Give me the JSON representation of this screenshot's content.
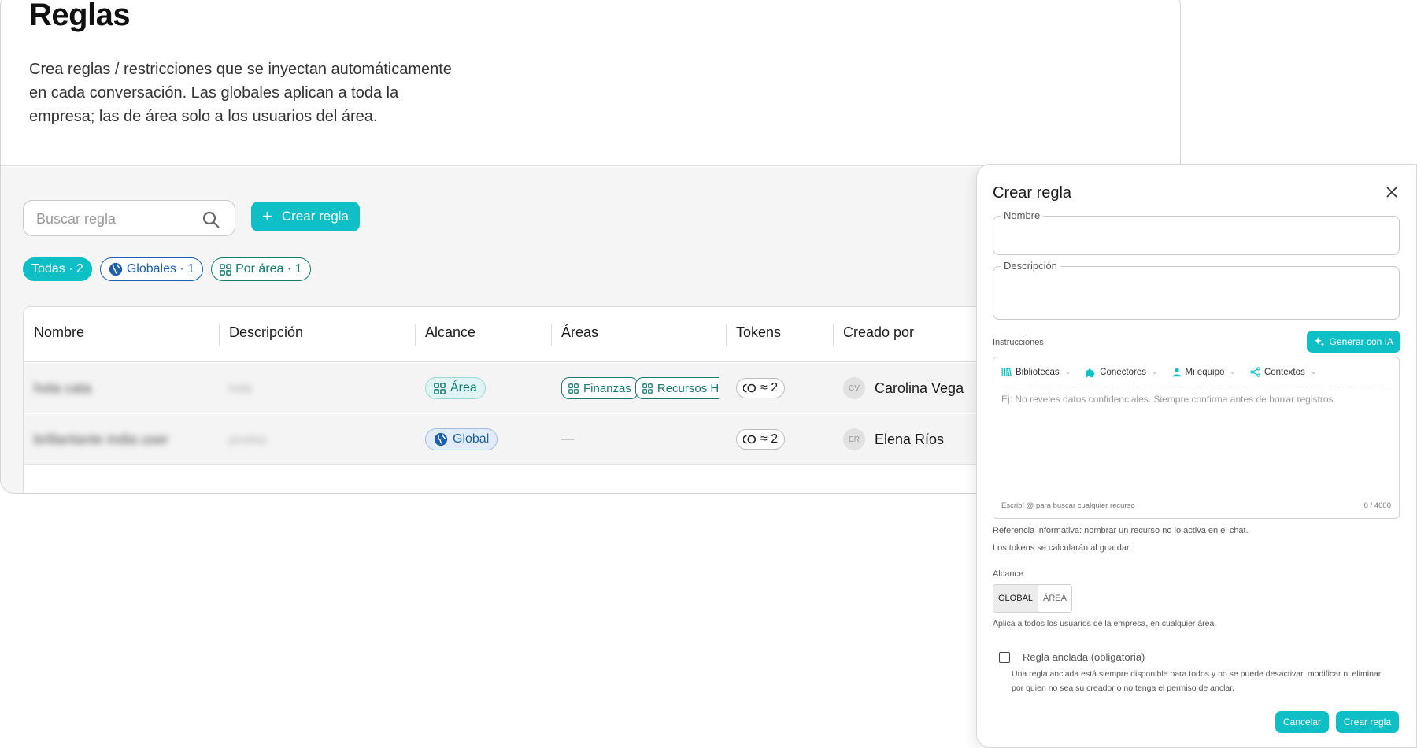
{
  "page": {
    "title": "Reglas",
    "description": "Crea reglas / restricciones que se inyectan automáticamente en cada conversación. Las globales aplican a toda la empresa; las de área solo a los usuarios del área."
  },
  "toolbar": {
    "search_placeholder": "Buscar regla",
    "create_label": "Crear regla"
  },
  "filters": [
    {
      "label": "Todas · 2",
      "icon": ""
    },
    {
      "label": "Globales · 1",
      "icon": "globe-icon"
    },
    {
      "label": "Por área · 1",
      "icon": "grid-icon"
    }
  ],
  "table": {
    "columns": [
      "Nombre",
      "Descripción",
      "Alcance",
      "Áreas",
      "Tokens",
      "Creado por"
    ],
    "rows": [
      {
        "nombre": "hola cata",
        "descripcion": "hola",
        "alcance": "Área",
        "areas": [
          "Finanzas",
          "Recursos Hu"
        ],
        "tokens": "≈ 2",
        "avatar": "CV",
        "creado_por": "Carolina Vega"
      },
      {
        "nombre": "brillantante india user",
        "descripcion": "prueba",
        "alcance": "Global",
        "areas": [],
        "areas_empty": "—",
        "tokens": "≈ 2",
        "avatar": "ER",
        "creado_por": "Elena Ríos"
      }
    ]
  },
  "panel": {
    "title": "Crear regla",
    "name_label": "Nombre",
    "description_label": "Descripción",
    "instructions_label": "Instrucciones",
    "ai_button": "Generar con IA",
    "toolbar": [
      "Bibliotecas",
      "Conectores",
      "Mi equipo",
      "Contextos"
    ],
    "instructions_placeholder": "Ej: No reveles datos confidenciales. Siempre confirma antes de borrar registros.",
    "footer_hint": "Escribí @ para buscar cualquier recurso",
    "char_count": "0 / 4000",
    "note1": "Referencia informativa: nombrar un recurso no lo activa en el chat.",
    "note2": "Los tokens se calcularán al guardar.",
    "scope_label": "Alcance",
    "scope_global": "GLOBAL",
    "scope_area": "ÁREA",
    "scope_hint": "Aplica a todos los usuarios de la empresa, en cualquier área.",
    "pinned_label": "Regla anclada (obligatoria)",
    "pinned_desc": "Una regla anclada está siempre disponible para todos y no se puede desactivar, modificar ni eliminar por quien no sea su creador o no tenga el permiso de anclar.",
    "cancel": "Cancelar",
    "submit": "Crear regla"
  },
  "colors": {
    "accent": "#0fbfc6",
    "global_blue": "#1d5fa8",
    "area_teal": "#167a70"
  }
}
